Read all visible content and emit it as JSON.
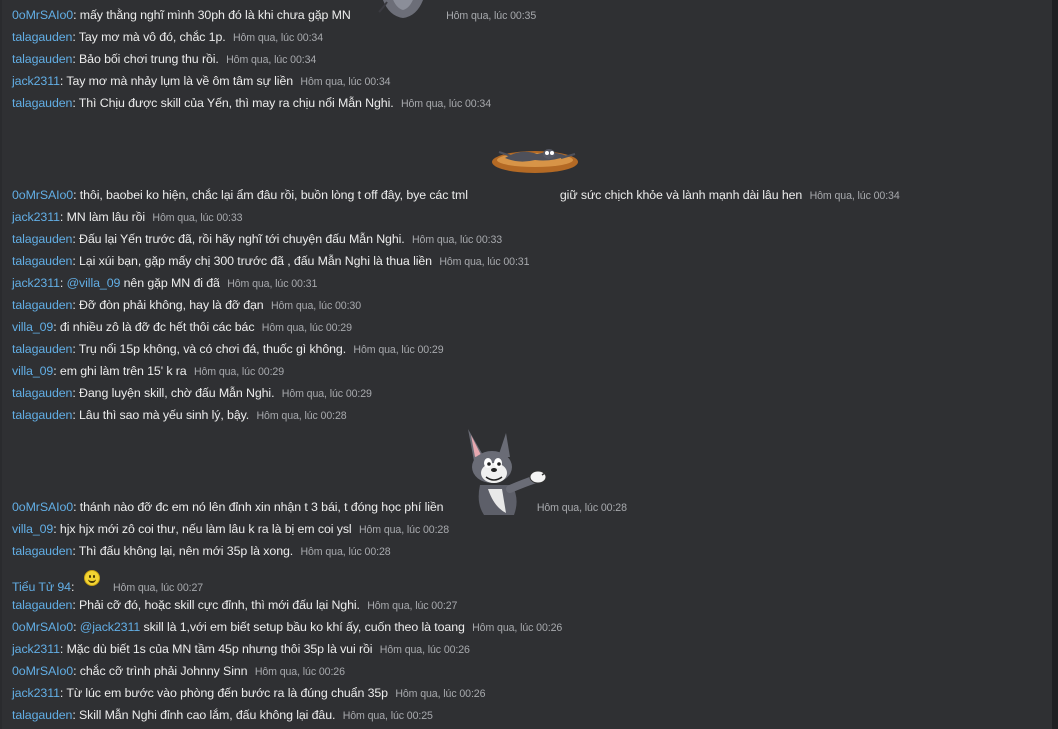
{
  "messages": [
    {
      "user": "0oMrSAIo0",
      "text": "mấy thằng nghĩ mình 30ph đó là khi chưa gặp MN",
      "time": "Hôm qua, lúc 00:35"
    },
    {
      "user": "talagauden",
      "text": "Tay mơ mà vô đó, chắc 1p.",
      "time": "Hôm qua, lúc 00:34"
    },
    {
      "user": "talagauden",
      "text": "Bảo bối chơi trung thu rồi.",
      "time": "Hôm qua, lúc 00:34"
    },
    {
      "user": "jack2311",
      "text": "Tay mơ mà nhảy lụm là về ôm tâm sự liền",
      "time": "Hôm qua, lúc 00:34"
    },
    {
      "user": "talagauden",
      "text": "Thì Chịu được skill của Yến, thì may ra chịu nổi Mẫn Nghi.",
      "time": "Hôm qua, lúc 00:34"
    },
    {
      "user": "0oMrSAIo0",
      "text": "thôi, baobei ko hiện, chắc lại ẩm đâu rồi, buồn lòng t off đây, bye các tml",
      "text2": "giữ sức chịch khỏe và lành mạnh dài lâu hen",
      "time": "Hôm qua, lúc 00:34"
    },
    {
      "user": "jack2311",
      "text": "MN làm lâu rồi",
      "time": "Hôm qua, lúc 00:33"
    },
    {
      "user": "talagauden",
      "text": "Đấu lại Yến trước đã, rồi hãy nghĩ tới chuyện đấu Mẫn Nghi.",
      "time": "Hôm qua, lúc 00:33"
    },
    {
      "user": "talagauden",
      "text": "Lại xúi bạn, gặp mấy chị 300 trước đã , đấu Mẫn Nghi là thua liền",
      "time": "Hôm qua, lúc 00:31"
    },
    {
      "user": "jack2311",
      "mention": "@villa_09",
      "text": "nên gặp MN đi đã",
      "time": "Hôm qua, lúc 00:31"
    },
    {
      "user": "talagauden",
      "text": "Đỡ đòn phải không, hay là đỡ đạn",
      "time": "Hôm qua, lúc 00:30"
    },
    {
      "user": "villa_09",
      "text": "đi nhiều zô là đỡ đc hết thôi các bác",
      "time": "Hôm qua, lúc 00:29"
    },
    {
      "user": "talagauden",
      "text": "Trụ nổi 15p không, và có chơi đá, thuốc gì không.",
      "time": "Hôm qua, lúc 00:29"
    },
    {
      "user": "villa_09",
      "text": "em ghi làm trên 15' k ra",
      "time": "Hôm qua, lúc 00:29"
    },
    {
      "user": "talagauden",
      "text": "Đang luyện skill, chờ đấu Mẫn Nghi.",
      "time": "Hôm qua, lúc 00:29"
    },
    {
      "user": "talagauden",
      "text": "Lâu thì sao mà yếu sinh lý, bậy.",
      "time": "Hôm qua, lúc 00:28"
    },
    {
      "user": "0oMrSAIo0",
      "text": "thánh nào đỡ đc em nó lên đỉnh xin nhận t 3 bái, t đóng học phí liền",
      "time": "Hôm qua, lúc 00:28"
    },
    {
      "user": "villa_09",
      "text": "hjx hjx mới zô coi thư, nếu làm lâu k ra là bị em coi ysl",
      "time": "Hôm qua, lúc 00:28"
    },
    {
      "user": "talagauden",
      "text": "Thì đấu không lại, nên mới 35p là xong.",
      "time": "Hôm qua, lúc 00:28"
    },
    {
      "user": "Tiểu Tử 94",
      "text": "",
      "emoji": "smiley-emoji",
      "time": "Hôm qua, lúc 00:27"
    },
    {
      "user": "talagauden",
      "text": "Phải cỡ đó, hoặc skill cực đỉnh, thì mới đấu lại Nghi.",
      "time": "Hôm qua, lúc 00:27"
    },
    {
      "user": "0oMrSAIo0",
      "mention": "@jack2311",
      "text": "skill là 1,với em biết setup bầu ko khí ấy, cuốn theo là toang",
      "time": "Hôm qua, lúc 00:26"
    },
    {
      "user": "jack2311",
      "text": "Mặc dù biết 1s của MN tầm 45p nhưng thôi 35p là vui rồi",
      "time": "Hôm qua, lúc 00:26"
    },
    {
      "user": "0oMrSAIo0",
      "text": "chắc cỡ trình phải Johnny Sinn",
      "time": "Hôm qua, lúc 00:26"
    },
    {
      "user": "jack2311",
      "text": "Từ lúc em bước vào phòng đến bước ra là đúng chuẩn 35p",
      "time": "Hôm qua, lúc 00:26"
    },
    {
      "user": "talagauden",
      "text": "Skill Mẫn Nghi đỉnh cao lắm, đấu không lại đâu.",
      "time": "Hôm qua, lúc 00:25"
    }
  ],
  "stickers": [
    "tom-cat-sticker",
    "flattened-tom-sticker",
    "tom-pointing-sticker"
  ],
  "colors": {
    "background": "#2f3033",
    "username": "#62aee5",
    "text": "#ececec",
    "timestamp": "#a7a9ad"
  }
}
